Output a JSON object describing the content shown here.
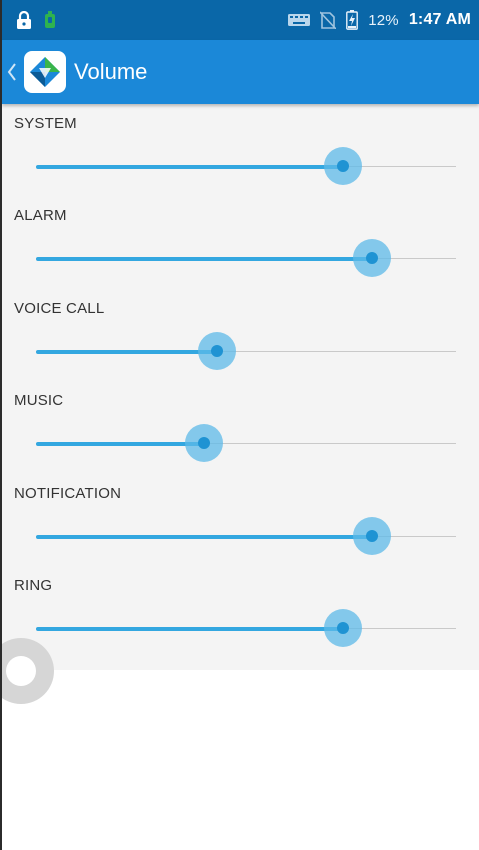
{
  "status_bar": {
    "icons": [
      "lock-icon",
      "android-debug-icon",
      "keyboard-icon",
      "no-sim-icon",
      "battery-charging-icon"
    ],
    "battery": "12%",
    "time": "1:47 AM"
  },
  "app_bar": {
    "title": "Volume",
    "back_icon": "chevron-left-icon",
    "logo_icon": "app-logo-icon"
  },
  "sliders": [
    {
      "id": "system",
      "label": "SYSTEM",
      "level": 0.73
    },
    {
      "id": "alarm",
      "label": "ALARM",
      "level": 0.8
    },
    {
      "id": "voice-call",
      "label": "VOICE CALL",
      "level": 0.43
    },
    {
      "id": "music",
      "label": "MUSIC",
      "level": 0.4
    },
    {
      "id": "notification",
      "label": "NOTIFICATION",
      "level": 0.8
    },
    {
      "id": "ring",
      "label": "RING",
      "level": 0.73
    }
  ],
  "colors": {
    "status_bar": "#0a67a8",
    "app_bar": "#1b88d8",
    "slider_fill": "#33a7e0",
    "slider_thumb": "#5ebae8",
    "panel_background": "#f4f4f4"
  }
}
